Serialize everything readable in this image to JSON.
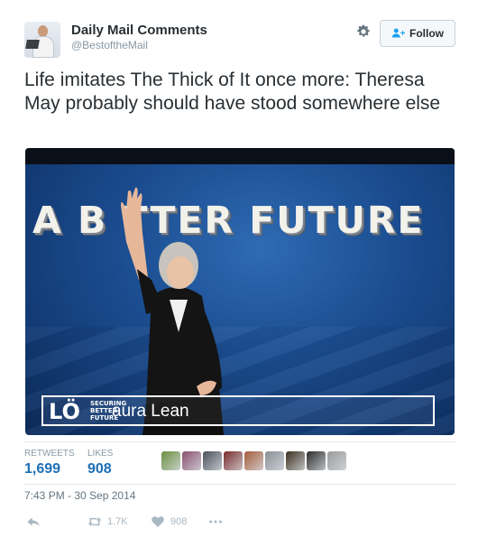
{
  "tweet": {
    "author_name": "Daily Mail Comments",
    "author_handle": "@BestoftheMail",
    "follow_label": "Follow",
    "text": "Life imitates The Thick of It once more: Theresa May probably should have stood somewhere else",
    "media": {
      "headline": "A B TTER FUTURE",
      "watermark_logo": "LÖ",
      "watermark_small_text": "SECURING\nBETTER\nFUTURE",
      "watermark_name": "aura Lean"
    },
    "stats": {
      "retweets_label": "RETWEETS",
      "retweets_value": "1,699",
      "likes_label": "LIKES",
      "likes_value": "908"
    },
    "liker_colors": [
      "#6b8f3e",
      "#8a4f6e",
      "#4a4f5a",
      "#7a2a2a",
      "#a65c3a",
      "#8a8f96",
      "#3c2f1e",
      "#2b2b2b",
      "#9a9a9a"
    ],
    "timestamp": "7:43 PM - 30 Sep 2014",
    "actions": {
      "reply_icon": "reply-icon",
      "retweet_count": "1.7K",
      "like_count": "908",
      "more_icon": "more-icon"
    }
  }
}
